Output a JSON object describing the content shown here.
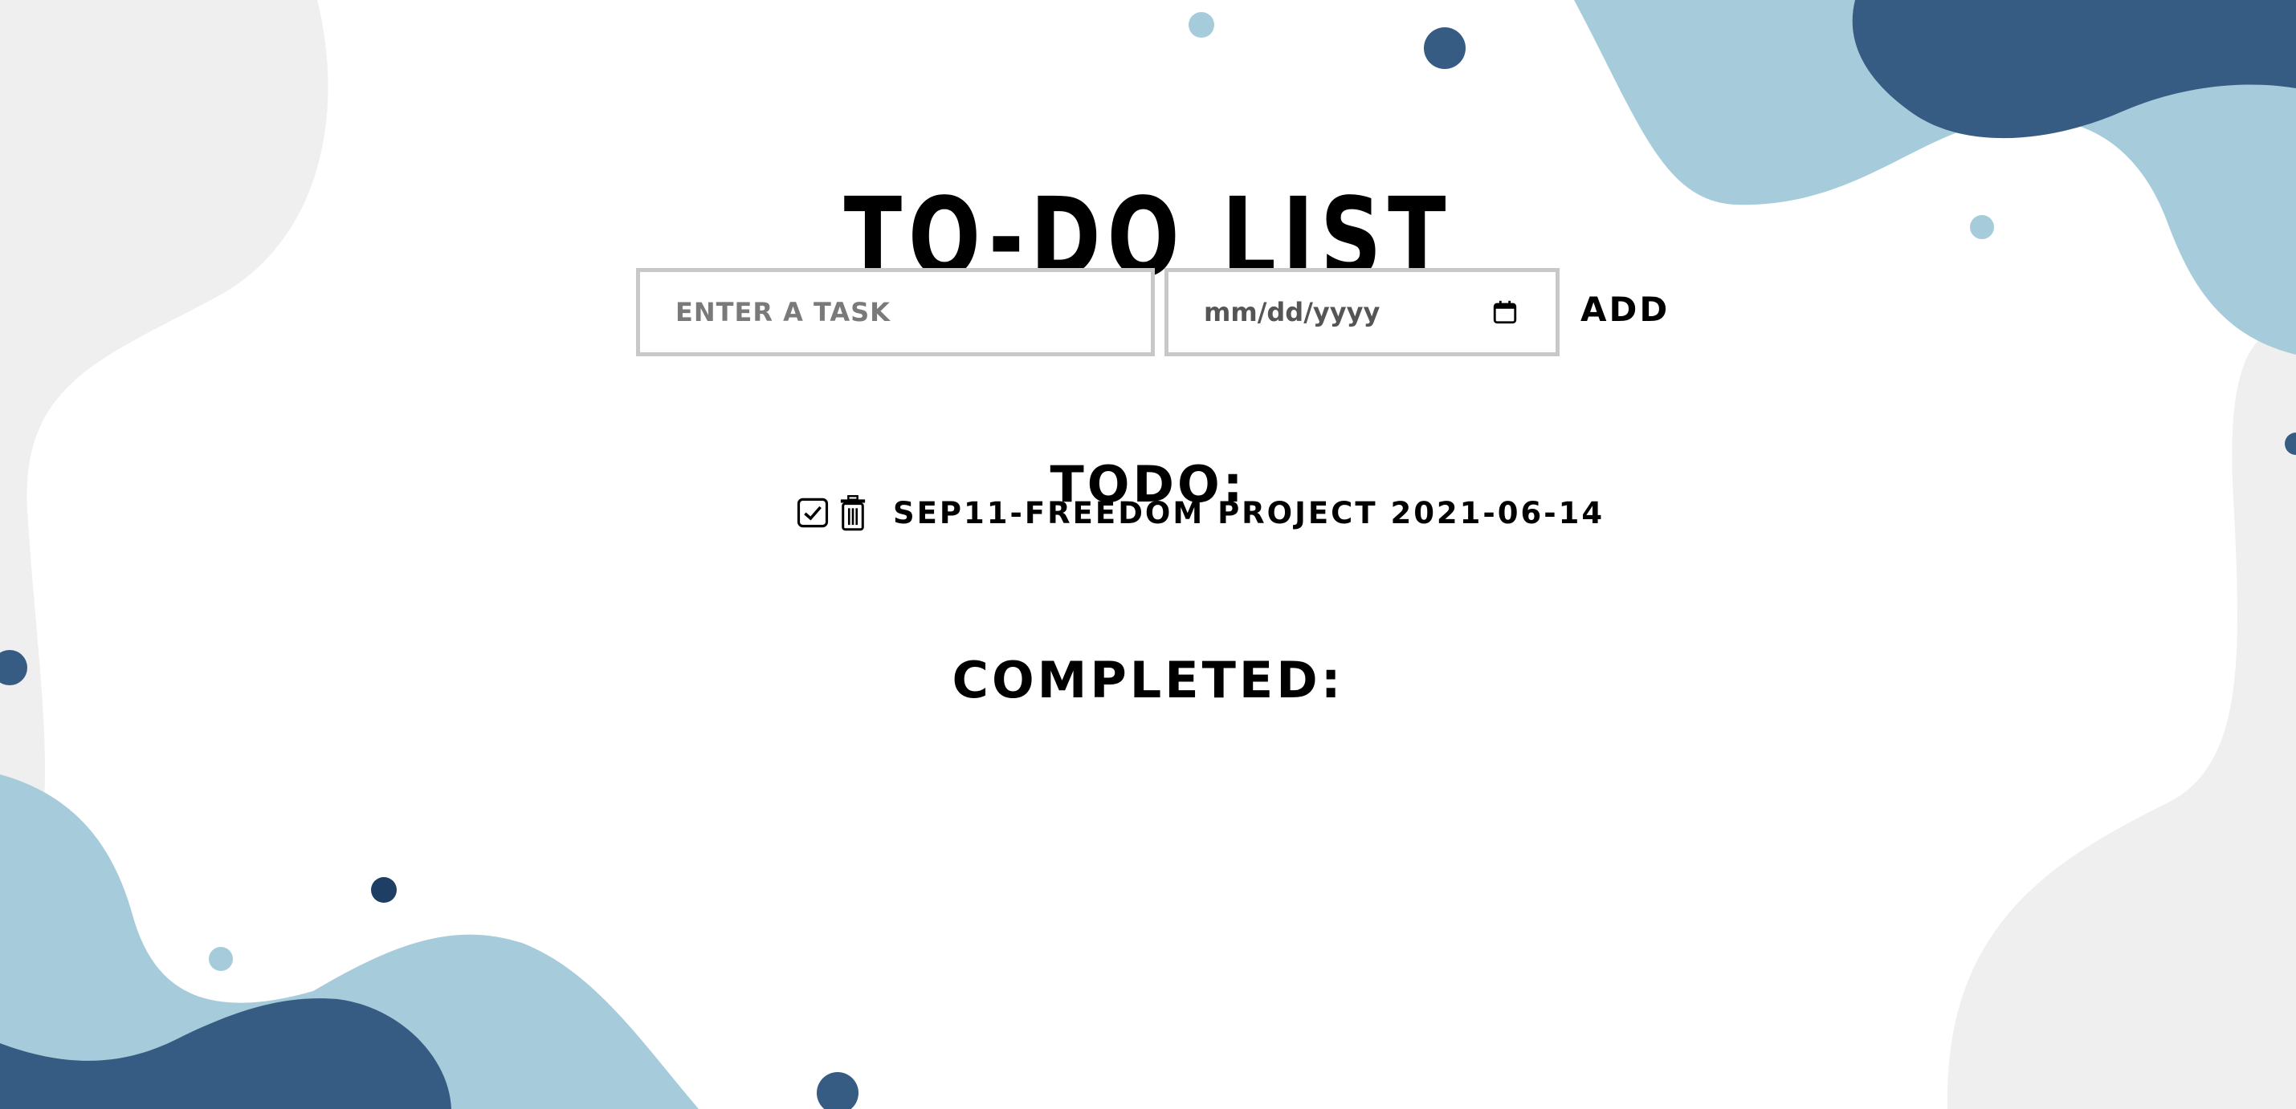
{
  "page": {
    "title": "TO-DO LIST"
  },
  "form": {
    "task_placeholder": "ENTER A TASK",
    "task_value": "",
    "date_placeholder": "mm/dd/yyyy",
    "add_label": "ADD"
  },
  "todo": {
    "heading": "TODO:",
    "items": [
      {
        "text": "SEP11-FREEDOM PROJECT 2021-06-14",
        "complete_icon": "checkbox-check-icon",
        "delete_icon": "trash-icon"
      }
    ]
  },
  "completed": {
    "heading": "COMPLETED:",
    "items": []
  },
  "icons": {
    "calendar": "calendar-icon"
  },
  "colors": {
    "light_blue": "#a6ccdb",
    "dark_blue": "#375c84",
    "light_gray": "#efefef",
    "text": "#000000",
    "input_border": "#c8c8c8"
  }
}
